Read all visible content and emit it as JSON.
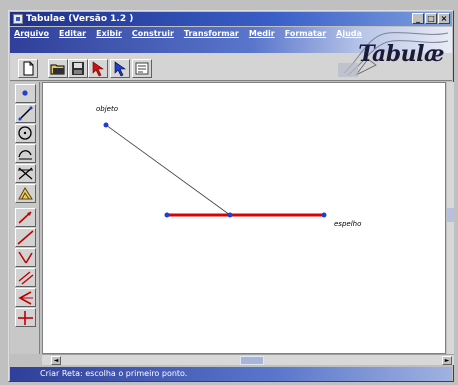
{
  "window": {
    "title": "Tabulae (Versão 1.2 )"
  },
  "titlebar_buttons": [
    "_",
    "□",
    "×"
  ],
  "menu": {
    "items": [
      "Arquivo",
      "Editar",
      "Exibir",
      "Construir",
      "Transformar",
      "Medir",
      "Formatar",
      "Ajuda"
    ]
  },
  "logo": {
    "text": "Tabulæ"
  },
  "toolbar": {
    "buttons": [
      "new-file-icon",
      "open-folder-icon",
      "save-disk-icon",
      "pointer-red-icon",
      "pointer-blue-icon",
      "properties-icon"
    ]
  },
  "sidebar": {
    "tools": [
      "point-icon",
      "segment-icon",
      "circle-icon",
      "arc-icon",
      "intersection-icon",
      "polygon-icon",
      "ray-icon",
      "line-icon",
      "angle-icon",
      "parallel-icon",
      "reflect-icon",
      "perpendicular-icon"
    ]
  },
  "canvas": {
    "labels": {
      "object": "objeto",
      "mirror": "espelho"
    }
  },
  "status": {
    "text": "Criar Reta: escolha o primeiro ponto."
  },
  "colors": {
    "accent": "#2a3f9f",
    "mirror_line": "#e00000",
    "point": "#1f3fcf"
  }
}
